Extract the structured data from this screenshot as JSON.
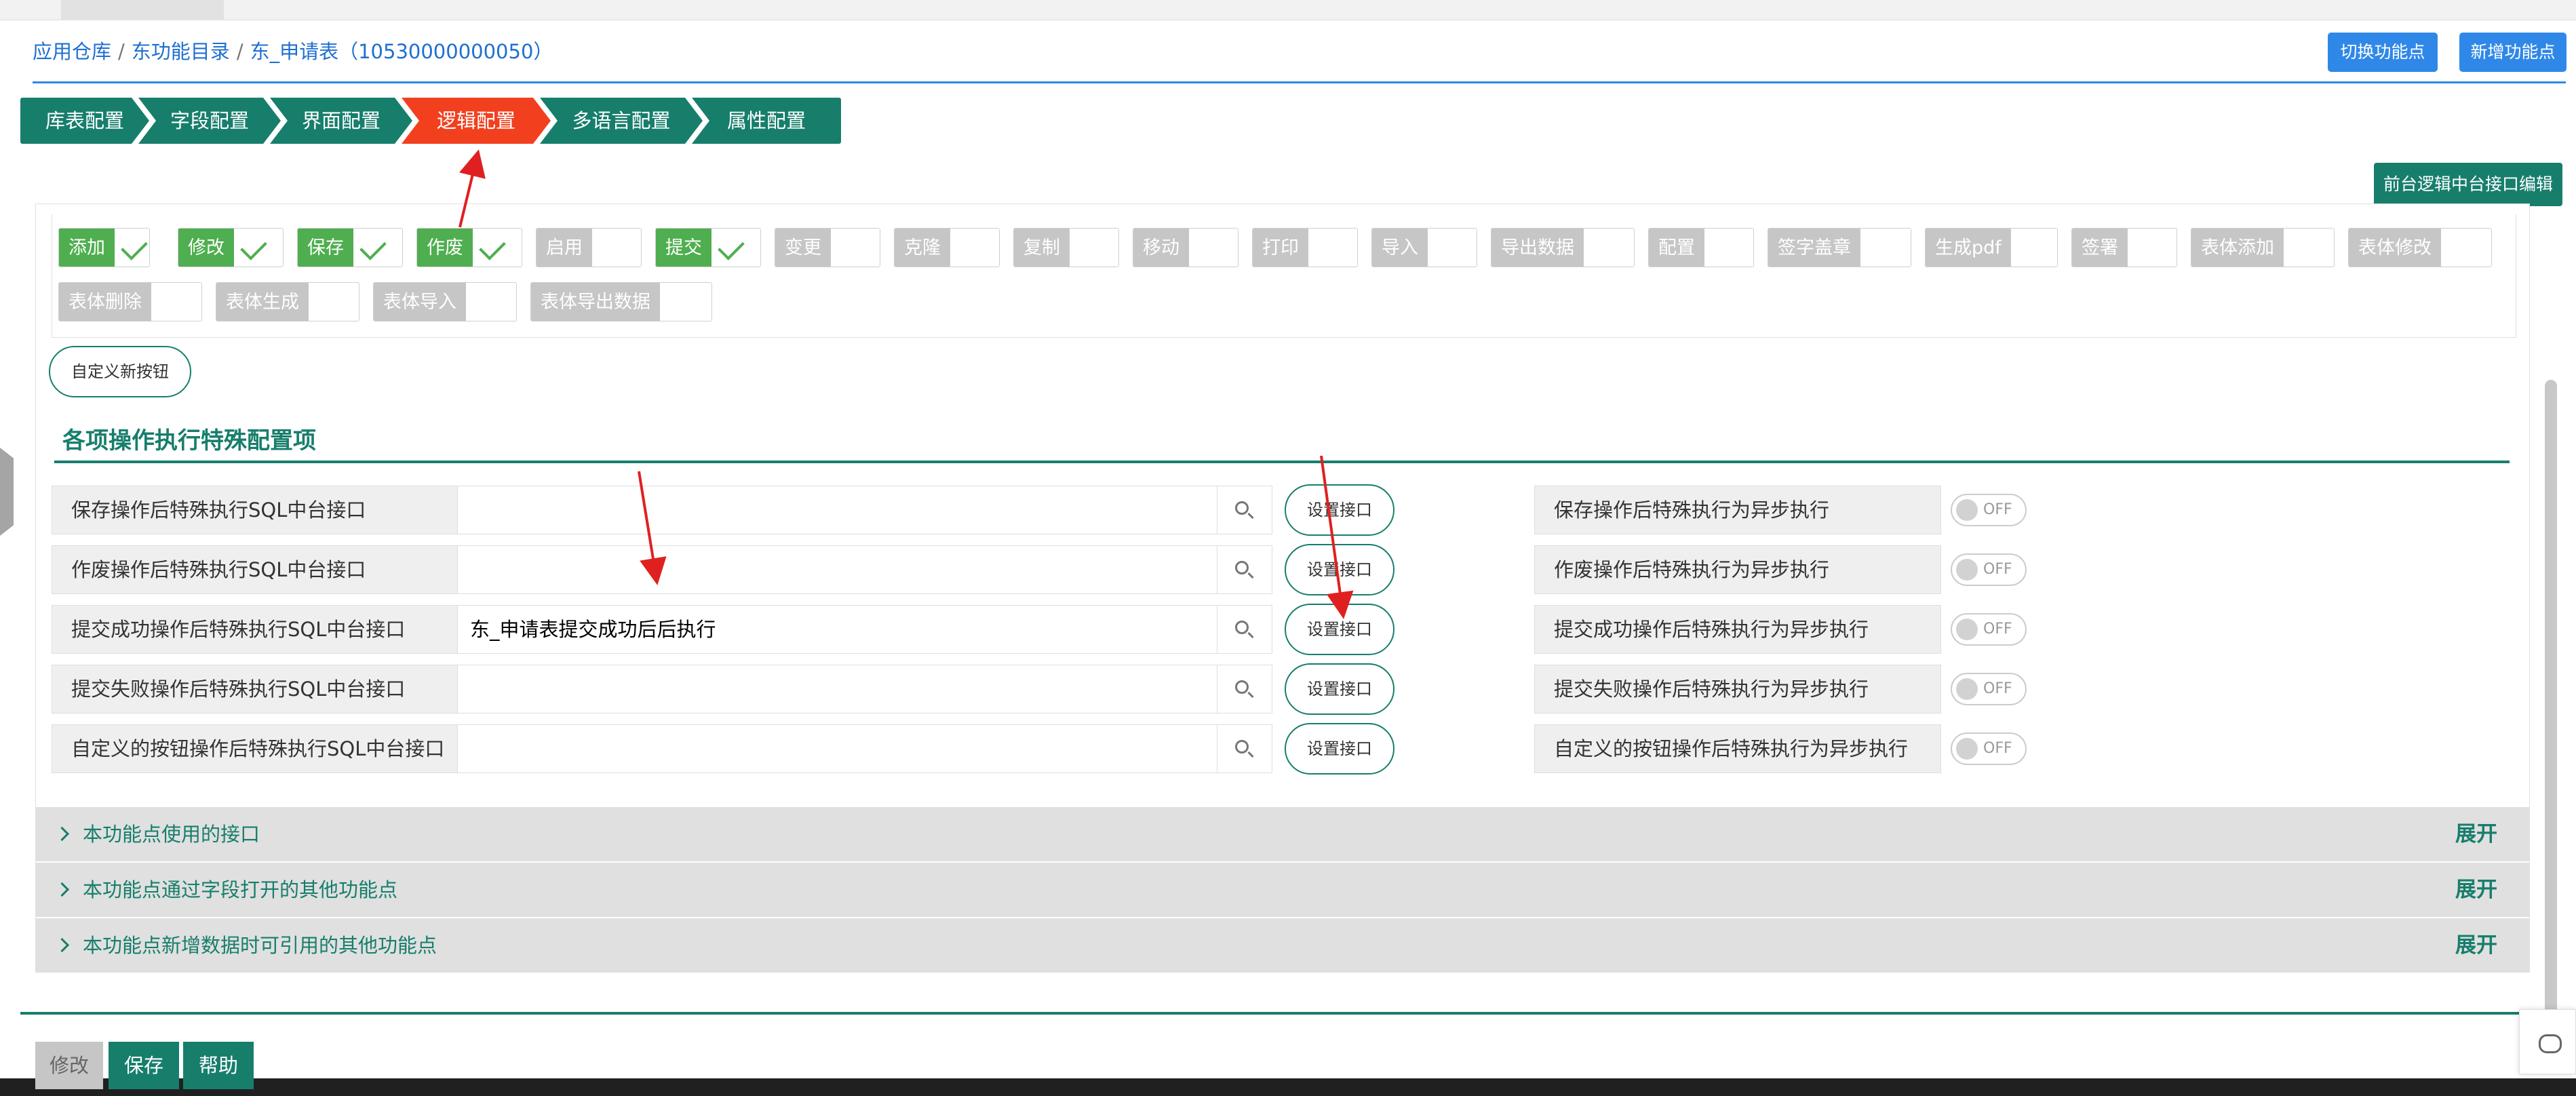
{
  "breadcrumb": [
    "应用仓库",
    "东功能目录",
    "东_申请表（10530000000050）"
  ],
  "breadcrumb_sep": "/",
  "header_buttons": {
    "switch": "切换功能点",
    "add": "新增功能点"
  },
  "steps": [
    "库表配置",
    "字段配置",
    "界面配置",
    "逻辑配置",
    "多语言配置",
    "属性配置"
  ],
  "active_step": "逻辑配置",
  "frontend_api_button": "前台逻辑中台接口编辑",
  "action_buttons_row1": [
    {
      "label": "添加",
      "on": true
    },
    {
      "label": "修改",
      "on": true
    },
    {
      "label": "保存",
      "on": true
    },
    {
      "label": "作废",
      "on": true
    },
    {
      "label": "启用",
      "on": false
    },
    {
      "label": "提交",
      "on": true
    },
    {
      "label": "变更",
      "on": false
    },
    {
      "label": "克隆",
      "on": false
    },
    {
      "label": "复制",
      "on": false
    },
    {
      "label": "移动",
      "on": false
    },
    {
      "label": "打印",
      "on": false
    },
    {
      "label": "导入",
      "on": false
    },
    {
      "label": "导出数据",
      "on": false
    },
    {
      "label": "配置",
      "on": false
    },
    {
      "label": "签字盖章",
      "on": false
    },
    {
      "label": "生成pdf",
      "on": false
    },
    {
      "label": "签署",
      "on": false
    },
    {
      "label": "表体添加",
      "on": false
    },
    {
      "label": "表体修改",
      "on": false
    }
  ],
  "action_buttons_row2": [
    {
      "label": "表体删除",
      "on": false
    },
    {
      "label": "表体生成",
      "on": false
    },
    {
      "label": "表体导入",
      "on": false
    },
    {
      "label": "表体导出数据",
      "on": false
    }
  ],
  "custom_button": "自定义新按钮",
  "section_title": "各项操作执行特殊配置项",
  "config_rows": [
    {
      "label": "保存操作后特殊执行SQL中台接口",
      "value": "",
      "button": "设置接口",
      "async_label": "保存操作后特殊执行为异步执行",
      "switch": "OFF"
    },
    {
      "label": "作废操作后特殊执行SQL中台接口",
      "value": "",
      "button": "设置接口",
      "async_label": "作废操作后特殊执行为异步执行",
      "switch": "OFF"
    },
    {
      "label": "提交成功操作后特殊执行SQL中台接口",
      "value": "东_申请表提交成功后后执行",
      "button": "设置接口",
      "async_label": "提交成功操作后特殊执行为异步执行",
      "switch": "OFF"
    },
    {
      "label": "提交失败操作后特殊执行SQL中台接口",
      "value": "",
      "button": "设置接口",
      "async_label": "提交失败操作后特殊执行为异步执行",
      "switch": "OFF"
    },
    {
      "label": "自定义的按钮操作后特殊执行SQL中台接口",
      "value": "",
      "button": "设置接口",
      "async_label": "自定义的按钮操作后特殊执行为异步执行",
      "switch": "OFF"
    }
  ],
  "collapsibles": [
    {
      "title": "本功能点使用的接口",
      "action": "展开"
    },
    {
      "title": "本功能点通过字段打开的其他功能点",
      "action": "展开"
    },
    {
      "title": "本功能点新增数据时可引用的其他功能点",
      "action": "展开"
    }
  ],
  "bottom_buttons": [
    "修改",
    "保存",
    "帮助"
  ],
  "colors": {
    "primary_green": "#177e6c",
    "active_step": "#f2401f",
    "blue": "#2f88e8",
    "toggle_on": "#4fae4f",
    "annotation_arrow": "#e02020"
  }
}
